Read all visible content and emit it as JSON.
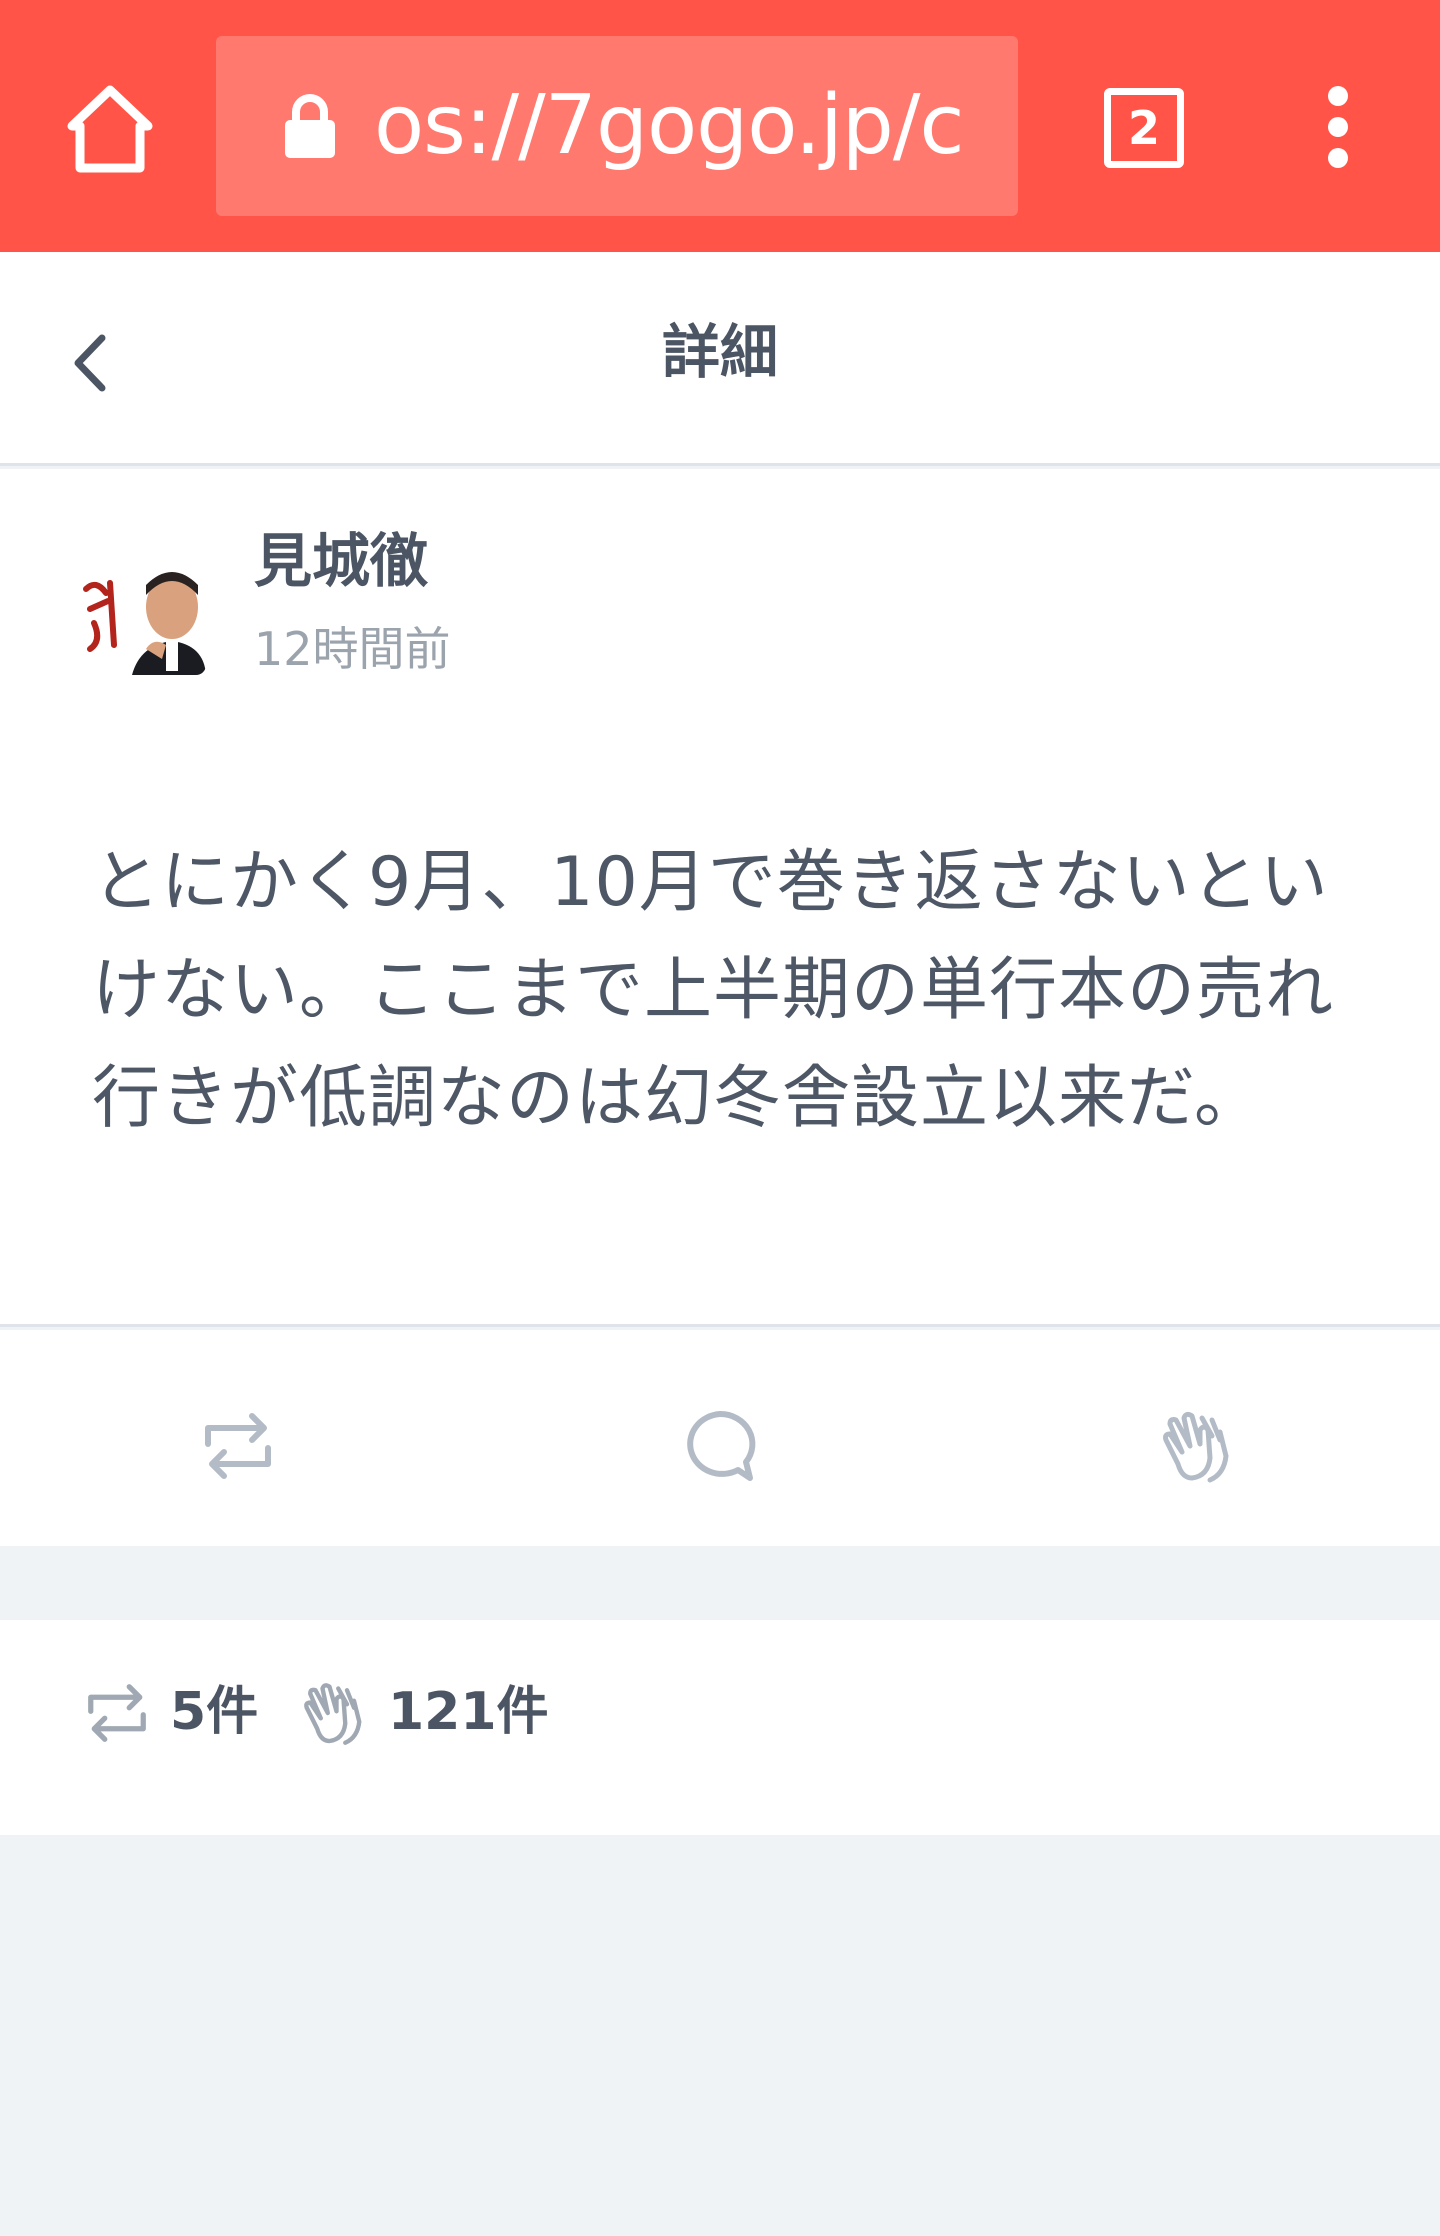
{
  "browser": {
    "url": "os://7gogo.jp/c",
    "tab_count": "2"
  },
  "header": {
    "title": "詳細"
  },
  "post": {
    "author": "見城徹",
    "time": "12時間前",
    "text": "とにかく9月、10月で巻き返さないといけない。ここまで上半期の単行本の売れ行きが低調なのは幻冬舎設立以来だ。"
  },
  "stats": {
    "repost_count": "5件",
    "clap_count": "121件"
  },
  "colors": {
    "browser_bar": "#ff5447",
    "icon_gray": "#b3bcc6",
    "text": "#4d5766"
  },
  "icons": [
    "home-icon",
    "lock-icon",
    "tab-count-icon",
    "more-vert-icon",
    "back-chevron-icon",
    "repost-icon",
    "comment-icon",
    "clap-icon"
  ]
}
